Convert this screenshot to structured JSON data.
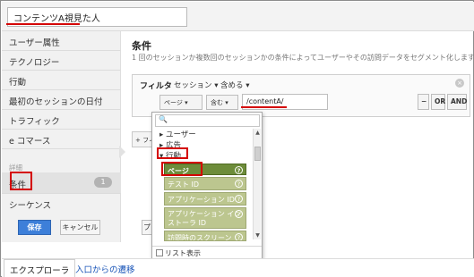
{
  "segment": {
    "name": "コンテンツA視見た人"
  },
  "sidebar": {
    "items": [
      {
        "label": "ユーザー属性"
      },
      {
        "label": "テクノロジー"
      },
      {
        "label": "行動"
      },
      {
        "label": "最初のセッションの日付"
      },
      {
        "label": "トラフィック"
      },
      {
        "label": "e コマース"
      }
    ],
    "section_label": "詳細",
    "conditions": {
      "label": "条件",
      "count": "1"
    },
    "sequences": {
      "label": "シーケンス"
    }
  },
  "main": {
    "title": "条件",
    "description": "1 回のセッションか複数回のセッションかの条件によってユーザーやその訪問データをセグメント化します。",
    "filter": {
      "label": "フィルタ",
      "scope": "セッション ▾",
      "mode": "含める ▾",
      "dimension": "ページ ▾",
      "operator": "含む ▾",
      "value": "/contentA/",
      "minus": "−",
      "or": "OR",
      "and": "AND",
      "close": "×"
    },
    "add_filter": "+ フィルタを追加"
  },
  "popup": {
    "search_icon": "🔍",
    "tree": [
      {
        "label": "▸ ユーザー"
      },
      {
        "label": "▸ 広告"
      },
      {
        "label": "▾ 行動"
      }
    ],
    "options": [
      {
        "label": "ページ"
      },
      {
        "label": "テスト ID"
      },
      {
        "label": "アプリケーション ID"
      },
      {
        "label": "アプリケーション インストーラ ID"
      },
      {
        "label": "訪問時のスクリーン"
      }
    ],
    "list_view": "リスト表示"
  },
  "buttons": {
    "save": "保存",
    "cancel": "キャンセル",
    "preview": "プレビュー"
  },
  "tabs": {
    "explorer": "エクスプローラ",
    "flow": "入口からの遷移"
  },
  "colors": {
    "accent": "#3d7fd9",
    "highlight": "#d40000",
    "selected": "#6d8c3a"
  }
}
